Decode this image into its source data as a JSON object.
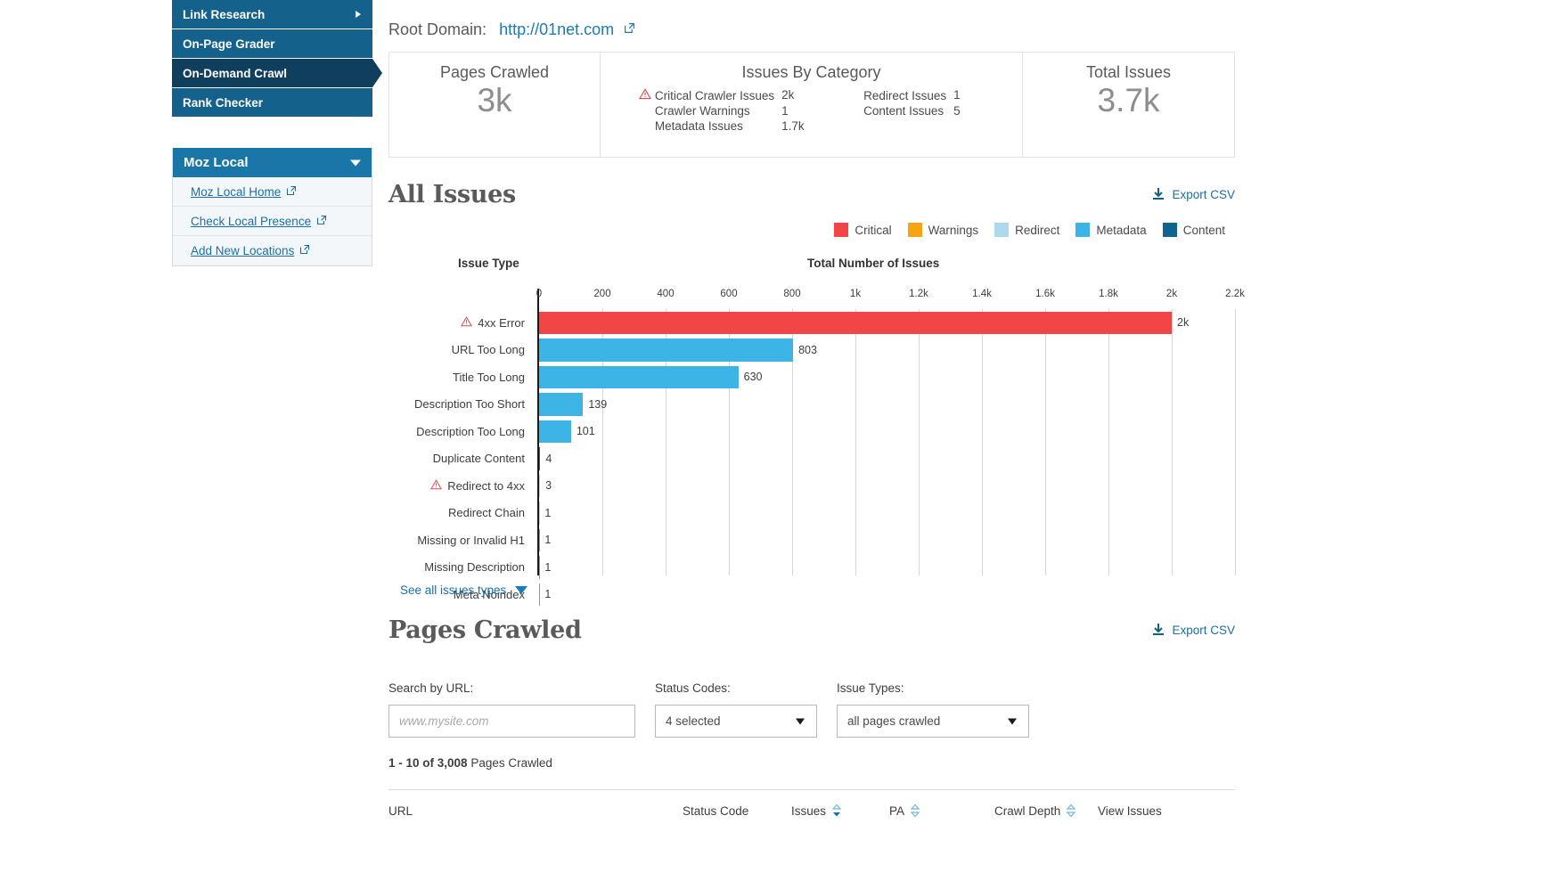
{
  "sidebar": {
    "nav_items": [
      {
        "label": "Link Research",
        "active": false,
        "has_caret": true
      },
      {
        "label": "On-Page Grader",
        "active": false,
        "has_caret": false
      },
      {
        "label": "On-Demand Crawl",
        "active": true,
        "has_caret": false
      },
      {
        "label": "Rank Checker",
        "active": false,
        "has_caret": false
      }
    ],
    "panel": {
      "title": "Moz Local",
      "links": [
        {
          "label": "Moz Local Home"
        },
        {
          "label": "Check Local Presence"
        },
        {
          "label": "Add New Locations"
        }
      ]
    }
  },
  "header": {
    "root_domain_label": "Root Domain:",
    "root_domain_url": "http://01net.com"
  },
  "summary": {
    "pages_crawled": {
      "title": "Pages Crawled",
      "value": "3k"
    },
    "issues_by_category": {
      "title": "Issues By Category",
      "left": [
        {
          "label": "Critical Crawler Issues",
          "value": "2k",
          "warning": true
        },
        {
          "label": "Crawler Warnings",
          "value": "1",
          "warning": false
        },
        {
          "label": "Metadata Issues",
          "value": "1.7k",
          "warning": false
        }
      ],
      "right": [
        {
          "label": "Redirect Issues",
          "value": "1"
        },
        {
          "label": "Content Issues",
          "value": "5"
        }
      ]
    },
    "total_issues": {
      "title": "Total Issues",
      "value": "3.7k"
    }
  },
  "all_issues": {
    "title": "All Issues",
    "export_label": "Export CSV",
    "see_all_label": "See all issues types",
    "legend": [
      {
        "label": "Critical",
        "color": "#f24646"
      },
      {
        "label": "Warnings",
        "color": "#f5a413"
      },
      {
        "label": "Redirect",
        "color": "#add9ee"
      },
      {
        "label": "Metadata",
        "color": "#3cb4e5"
      },
      {
        "label": "Content",
        "color": "#10658f"
      }
    ]
  },
  "chart_data": {
    "type": "bar",
    "orientation": "horizontal",
    "title": "All Issues",
    "xlabel": "Total Number of Issues",
    "ylabel": "Issue Type",
    "xlim": [
      0,
      2200
    ],
    "xticks": [
      "0",
      "200",
      "400",
      "600",
      "800",
      "1k",
      "1.2k",
      "1.4k",
      "1.6k",
      "1.8k",
      "2k",
      "2.2k"
    ],
    "xtick_values": [
      0,
      200,
      400,
      600,
      800,
      1000,
      1200,
      1400,
      1600,
      1800,
      2000,
      2200
    ],
    "grid": true,
    "legend_position": "top-right",
    "categories": [
      "4xx Error",
      "URL Too Long",
      "Title Too Long",
      "Description Too Short",
      "Description Too Long",
      "Duplicate Content",
      "Redirect to 4xx",
      "Redirect Chain",
      "Missing or Invalid H1",
      "Missing Description",
      "Meta Noindex"
    ],
    "values": [
      2000,
      803,
      630,
      139,
      101,
      4,
      3,
      1,
      1,
      1,
      1
    ],
    "data_labels": [
      "2k",
      "803",
      "630",
      "139",
      "101",
      "4",
      "3",
      "1",
      "1",
      "1",
      "1"
    ],
    "bar_colors": [
      "#f24646",
      "#3cb4e5",
      "#3cb4e5",
      "#3cb4e5",
      "#3cb4e5",
      "#10658f",
      "#add9ee",
      "#add9ee",
      "#3cb4e5",
      "#3cb4e5",
      "#3cb4e5"
    ],
    "warning_icons": [
      true,
      false,
      false,
      false,
      false,
      false,
      true,
      false,
      false,
      false,
      false
    ]
  },
  "pages_crawled": {
    "title": "Pages Crawled",
    "export_label": "Export CSV",
    "filters": {
      "search_label": "Search by URL:",
      "search_placeholder": "www.mysite.com",
      "search_value": "",
      "status_label": "Status Codes:",
      "status_value": "4 selected",
      "issue_label": "Issue Types:",
      "issue_value": "all pages crawled"
    },
    "count_prefix": "1 - 10 of 3,008",
    "count_suffix": "Pages Crawled",
    "table_headers": [
      {
        "label": "URL",
        "sortable": false
      },
      {
        "label": "Status Code",
        "sortable": false
      },
      {
        "label": "Issues",
        "sortable": true
      },
      {
        "label": "PA",
        "sortable": true
      },
      {
        "label": "Crawl Depth",
        "sortable": true
      },
      {
        "label": "View Issues",
        "sortable": false
      }
    ]
  }
}
